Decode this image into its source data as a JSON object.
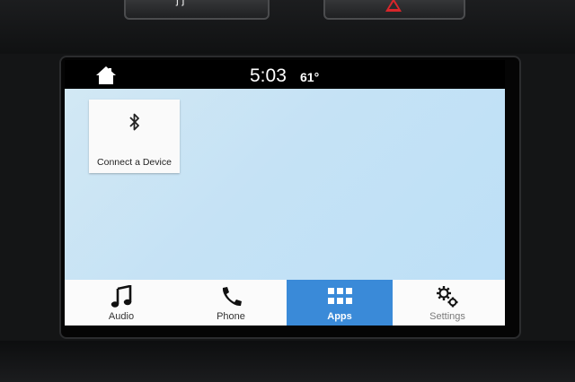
{
  "status_bar": {
    "time": "5:03",
    "temperature": "61°",
    "home_icon": "home-icon"
  },
  "hardware": {
    "left_button_glyph": "j j",
    "right_button_icon": "hazard-triangle-icon"
  },
  "tiles": [
    {
      "label": "Connect a Device",
      "icon": "bluetooth-icon"
    }
  ],
  "tabs": [
    {
      "label": "Audio",
      "icon": "music-note-icon",
      "active": false
    },
    {
      "label": "Phone",
      "icon": "phone-icon",
      "active": false
    },
    {
      "label": "Apps",
      "icon": "apps-grid-icon",
      "active": true
    },
    {
      "label": "Settings",
      "icon": "gears-icon",
      "active": false
    }
  ],
  "colors": {
    "active_tab": "#3a8ad8",
    "hazard": "#d8262b",
    "content_background": "#c5e2f5"
  }
}
